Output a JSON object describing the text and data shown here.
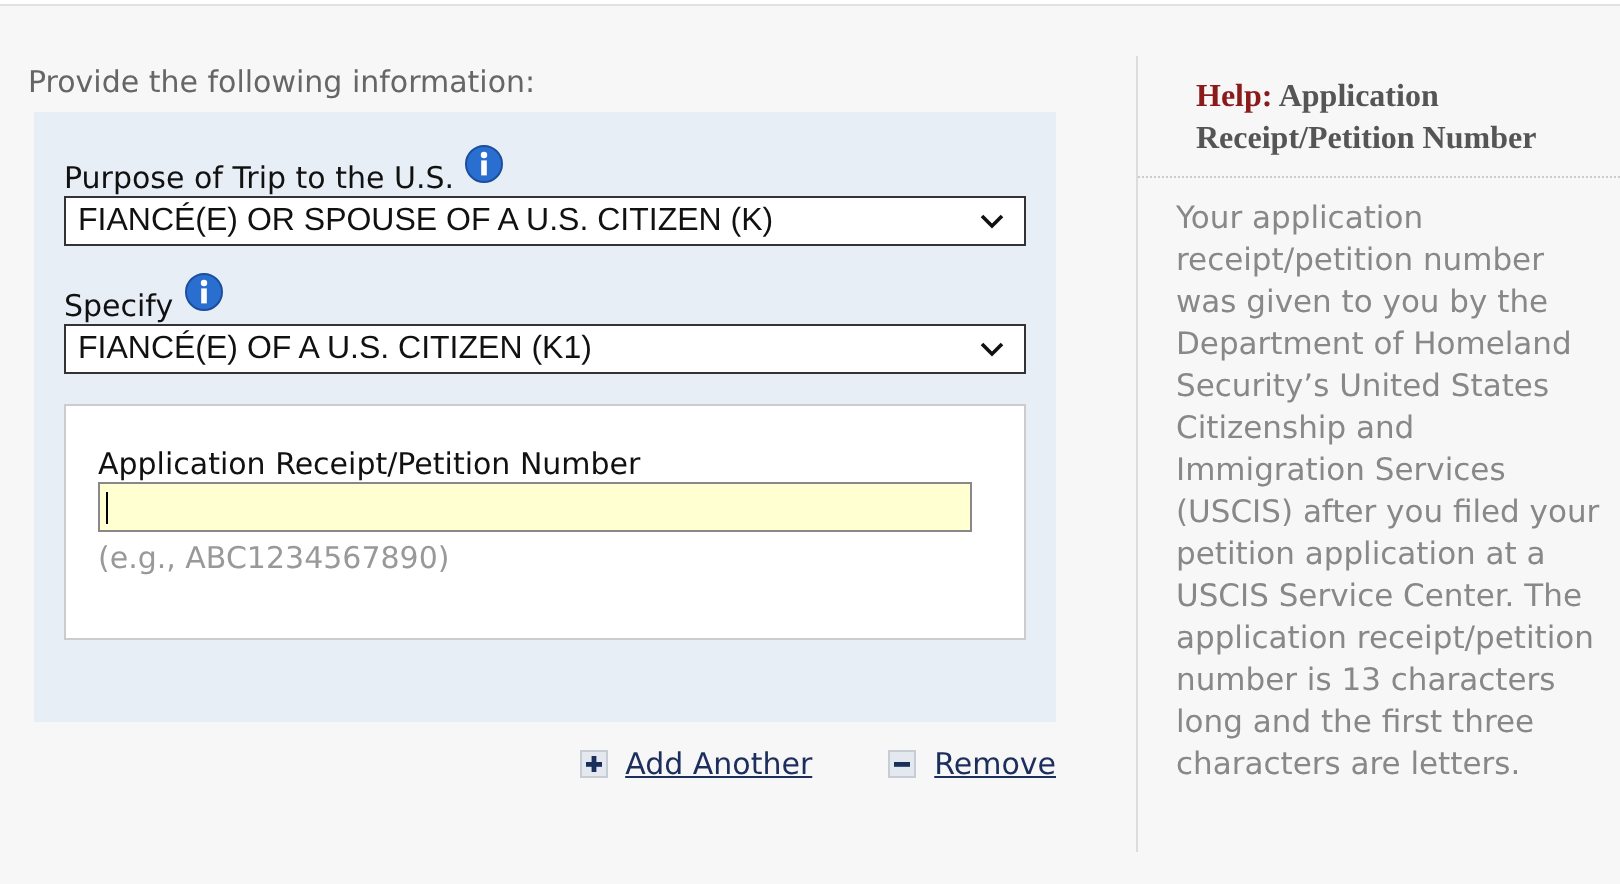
{
  "intro": "Provide the following information:",
  "selects": [
    {
      "label": "Purpose of Trip to the U.S.",
      "value": "FIANCÉ(E) OR SPOUSE OF A U.S. CITIZEN (K)"
    },
    {
      "label": "Specify",
      "value": "FIANCÉ(E) OF A U.S. CITIZEN (K1)"
    }
  ],
  "receipt": {
    "label": "Application Receipt/Petition Number",
    "focused": true,
    "example": "(e.g., ABC1234567890)"
  },
  "actions": [
    {
      "kind": "add",
      "label": "Add Another"
    },
    {
      "kind": "remove",
      "label": "Remove"
    }
  ],
  "help": {
    "label": "Help:",
    "title": "Application Receipt/Petition Number",
    "text": "Your application receipt/petition number was given to you by the Department of Homeland Security’s United States Citizenship and Immigration Services (USCIS) after you filed your petition application at a USCIS Service Center. The application receipt/petition number is 13 characters long and the first three characters are letters."
  }
}
